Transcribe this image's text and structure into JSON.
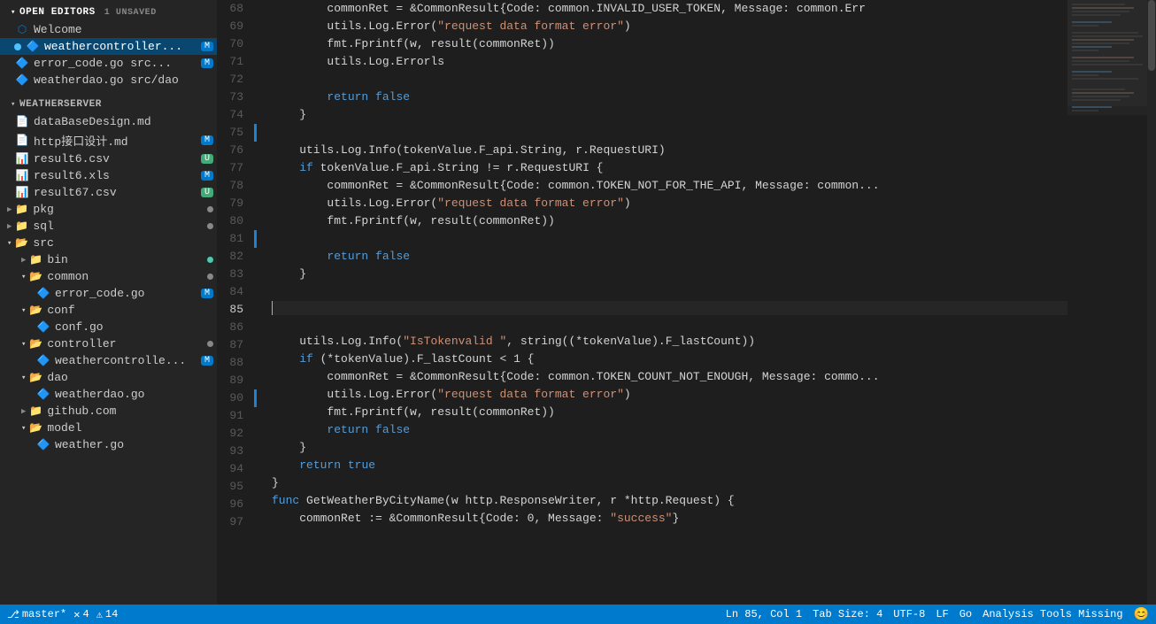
{
  "sidebar": {
    "open_editors_label": "OPEN EDITORS",
    "open_editors_badge": "1 UNSAVED",
    "items_open": [
      {
        "id": "welcome",
        "icon": "vscode",
        "label": "Welcome",
        "indent": 16,
        "badge": null,
        "dot": null
      },
      {
        "id": "weathercontroller",
        "icon": "go",
        "label": "weathercontroller...",
        "indent": 16,
        "badge": "M",
        "dot": "blue",
        "active": true
      },
      {
        "id": "error_code_go",
        "icon": "go",
        "label": "error_code.go  src...",
        "indent": 16,
        "badge": "M",
        "dot": null
      },
      {
        "id": "weatherdao_go",
        "icon": "go",
        "label": "weatherdao.go  src/dao",
        "indent": 16,
        "badge": null,
        "dot": null
      }
    ],
    "weatherserver_label": "WEATHERSERVER",
    "tree": [
      {
        "id": "dataBaseDesign",
        "icon": "md",
        "label": "dataBaseDesign.md",
        "indent": 16,
        "badge": null,
        "dot": null,
        "type": "file"
      },
      {
        "id": "http_design",
        "icon": "md",
        "label": "http接口设计.md",
        "indent": 16,
        "badge": "M",
        "dot": null,
        "type": "file"
      },
      {
        "id": "result6_csv",
        "icon": "csv",
        "label": "result6.csv",
        "indent": 16,
        "badge": "U",
        "dot": null,
        "type": "file"
      },
      {
        "id": "result6_xls",
        "icon": "xls",
        "label": "result6.xls",
        "indent": 16,
        "badge": "M",
        "dot": null,
        "type": "file"
      },
      {
        "id": "result67_csv",
        "icon": "csv",
        "label": "result67.csv",
        "indent": 16,
        "badge": "U",
        "dot": null,
        "type": "file"
      },
      {
        "id": "pkg",
        "icon": "folder",
        "label": "pkg",
        "indent": 8,
        "badge": null,
        "dot": "gray",
        "type": "folder"
      },
      {
        "id": "sql",
        "icon": "folder",
        "label": "sql",
        "indent": 8,
        "badge": null,
        "dot": "gray",
        "type": "folder"
      },
      {
        "id": "src",
        "icon": "folder",
        "label": "src",
        "indent": 8,
        "badge": null,
        "dot": null,
        "type": "folder-open"
      },
      {
        "id": "bin",
        "icon": "folder",
        "label": "bin",
        "indent": 24,
        "badge": null,
        "dot": "green",
        "type": "folder"
      },
      {
        "id": "common",
        "icon": "folder",
        "label": "common",
        "indent": 24,
        "badge": null,
        "dot": "gray",
        "type": "folder-open"
      },
      {
        "id": "error_code_go2",
        "icon": "go",
        "label": "error_code.go",
        "indent": 40,
        "badge": "M",
        "dot": null,
        "type": "file"
      },
      {
        "id": "conf",
        "icon": "folder",
        "label": "conf",
        "indent": 24,
        "badge": null,
        "dot": null,
        "type": "folder-open"
      },
      {
        "id": "conf_go",
        "icon": "go",
        "label": "conf.go",
        "indent": 40,
        "badge": null,
        "dot": null,
        "type": "file"
      },
      {
        "id": "controller",
        "icon": "folder",
        "label": "controller",
        "indent": 24,
        "badge": null,
        "dot": "gray",
        "type": "folder-open"
      },
      {
        "id": "weathercontrolle",
        "icon": "go",
        "label": "weathercontrolle...",
        "indent": 40,
        "badge": "M",
        "dot": null,
        "type": "file"
      },
      {
        "id": "dao",
        "icon": "folder",
        "label": "dao",
        "indent": 24,
        "badge": null,
        "dot": null,
        "type": "folder-open"
      },
      {
        "id": "weatherdao_go2",
        "icon": "go",
        "label": "weatherdao.go",
        "indent": 40,
        "badge": null,
        "dot": null,
        "type": "file"
      },
      {
        "id": "github_com",
        "icon": "folder",
        "label": "github.com",
        "indent": 24,
        "badge": null,
        "dot": null,
        "type": "folder"
      },
      {
        "id": "model",
        "icon": "folder",
        "label": "model",
        "indent": 24,
        "badge": null,
        "dot": null,
        "type": "folder-open"
      },
      {
        "id": "weather_go",
        "icon": "go",
        "label": "weather.go",
        "indent": 40,
        "badge": null,
        "dot": null,
        "type": "file"
      }
    ]
  },
  "code": {
    "lines": [
      {
        "num": 68,
        "change": "none",
        "tokens": [
          {
            "t": "plain",
            "v": "        commonRet = &CommonResult{Code: common.INVALID_USER_TOKEN, Message: common.Er..."
          }
        ]
      },
      {
        "num": 69,
        "change": "none",
        "tokens": [
          {
            "t": "plain",
            "v": "        utils.Log.Error("
          },
          {
            "t": "str",
            "v": "\"request data format error\""
          },
          {
            "t": "plain",
            "v": ")"
          }
        ]
      },
      {
        "num": 70,
        "change": "none",
        "tokens": [
          {
            "t": "plain",
            "v": "        fmt.Fprintf(w, result(commonRet))"
          }
        ]
      },
      {
        "num": 71,
        "change": "none",
        "tokens": [
          {
            "t": "plain",
            "v": "        utils.Log.Errorls"
          }
        ]
      },
      {
        "num": 72,
        "change": "none",
        "tokens": []
      },
      {
        "num": 73,
        "change": "none",
        "tokens": [
          {
            "t": "plain",
            "v": "        "
          },
          {
            "t": "kw",
            "v": "return"
          },
          {
            "t": "plain",
            "v": " "
          },
          {
            "t": "bool",
            "v": "false"
          }
        ]
      },
      {
        "num": 74,
        "change": "none",
        "tokens": [
          {
            "t": "plain",
            "v": "    }"
          }
        ]
      },
      {
        "num": 75,
        "change": "modified",
        "tokens": []
      },
      {
        "num": 76,
        "change": "none",
        "tokens": [
          {
            "t": "plain",
            "v": "    utils.Log.Info(tokenValue.F_api.String, r.RequestURI)"
          }
        ]
      },
      {
        "num": 77,
        "change": "none",
        "tokens": [
          {
            "t": "plain",
            "v": "    "
          },
          {
            "t": "kw",
            "v": "if"
          },
          {
            "t": "plain",
            "v": " tokenValue.F_api.String != r.RequestURI {"
          }
        ]
      },
      {
        "num": 78,
        "change": "none",
        "tokens": [
          {
            "t": "plain",
            "v": "        commonRet = &CommonResult{Code: common.TOKEN_NOT_FOR_THE_API, Message: common..."
          }
        ]
      },
      {
        "num": 79,
        "change": "none",
        "tokens": [
          {
            "t": "plain",
            "v": "        utils.Log.Error("
          },
          {
            "t": "str",
            "v": "\"request data format error\""
          },
          {
            "t": "plain",
            "v": ")"
          }
        ]
      },
      {
        "num": 80,
        "change": "none",
        "tokens": [
          {
            "t": "plain",
            "v": "        fmt.Fprintf(w, result(commonRet))"
          }
        ]
      },
      {
        "num": 81,
        "change": "modified",
        "tokens": []
      },
      {
        "num": 82,
        "change": "none",
        "tokens": [
          {
            "t": "plain",
            "v": "        "
          },
          {
            "t": "kw",
            "v": "return"
          },
          {
            "t": "plain",
            "v": " "
          },
          {
            "t": "bool",
            "v": "false"
          }
        ]
      },
      {
        "num": 83,
        "change": "none",
        "tokens": [
          {
            "t": "plain",
            "v": "    }"
          }
        ]
      },
      {
        "num": 84,
        "change": "none",
        "tokens": []
      },
      {
        "num": 85,
        "change": "none",
        "tokens": [
          {
            "t": "cursor",
            "v": ""
          }
        ],
        "cursor": true
      },
      {
        "num": 86,
        "change": "none",
        "tokens": []
      },
      {
        "num": 87,
        "change": "none",
        "tokens": [
          {
            "t": "plain",
            "v": "    utils.Log.Info("
          },
          {
            "t": "str",
            "v": "\"IsTokenvalid \""
          },
          {
            "t": "plain",
            "v": ", string((*tokenValue).F_lastCount))"
          }
        ]
      },
      {
        "num": 88,
        "change": "none",
        "tokens": [
          {
            "t": "plain",
            "v": "    "
          },
          {
            "t": "kw",
            "v": "if"
          },
          {
            "t": "plain",
            "v": " (*tokenValue).F_lastCount < 1 {"
          }
        ]
      },
      {
        "num": 89,
        "change": "none",
        "tokens": [
          {
            "t": "plain",
            "v": "        commonRet = &CommonResult{Code: common.TOKEN_COUNT_NOT_ENOUGH, Message: commo..."
          }
        ]
      },
      {
        "num": 90,
        "change": "modified",
        "tokens": [
          {
            "t": "plain",
            "v": "        utils.Log.Error("
          },
          {
            "t": "str",
            "v": "\"request data format error\""
          },
          {
            "t": "plain",
            "v": ")"
          }
        ]
      },
      {
        "num": 91,
        "change": "none",
        "tokens": [
          {
            "t": "plain",
            "v": "        fmt.Fprintf(w, result(commonRet))"
          }
        ]
      },
      {
        "num": 92,
        "change": "none",
        "tokens": [
          {
            "t": "plain",
            "v": "        "
          },
          {
            "t": "kw",
            "v": "return"
          },
          {
            "t": "plain",
            "v": " "
          },
          {
            "t": "bool",
            "v": "false"
          }
        ]
      },
      {
        "num": 93,
        "change": "none",
        "tokens": [
          {
            "t": "plain",
            "v": "    }"
          }
        ]
      },
      {
        "num": 94,
        "change": "none",
        "tokens": [
          {
            "t": "plain",
            "v": "    "
          },
          {
            "t": "kw",
            "v": "return"
          },
          {
            "t": "plain",
            "v": " "
          },
          {
            "t": "bool",
            "v": "true"
          }
        ]
      },
      {
        "num": 95,
        "change": "none",
        "tokens": [
          {
            "t": "plain",
            "v": "}"
          }
        ]
      },
      {
        "num": 96,
        "change": "none",
        "tokens": [
          {
            "t": "kw",
            "v": "func"
          },
          {
            "t": "plain",
            "v": " GetWeatherByCityName(w http.ResponseWriter, r *http.Request) {"
          }
        ]
      },
      {
        "num": 97,
        "change": "none",
        "tokens": [
          {
            "t": "plain",
            "v": "    commonRet := &CommonResult{Code: 0, Message: "
          },
          {
            "t": "str",
            "v": "\"success\""
          },
          {
            "t": "plain",
            "v": "}"
          }
        ]
      }
    ]
  },
  "status_bar": {
    "left": [
      {
        "id": "git-icon",
        "icon": "⎇",
        "label": "master*"
      },
      {
        "id": "error-count",
        "icon": "✕",
        "label": "4"
      },
      {
        "id": "warning-count",
        "icon": "⚠",
        "label": "14"
      }
    ],
    "right": [
      {
        "id": "cursor-pos",
        "label": "Ln 85, Col 1"
      },
      {
        "id": "tab-size",
        "label": "Tab Size: 4"
      },
      {
        "id": "encoding",
        "label": "UTF-8"
      },
      {
        "id": "line-ending",
        "label": "LF"
      },
      {
        "id": "language",
        "label": "Go"
      },
      {
        "id": "analysis-tools",
        "label": "Analysis Tools Missing"
      },
      {
        "id": "smiley",
        "icon": "😊"
      }
    ]
  }
}
